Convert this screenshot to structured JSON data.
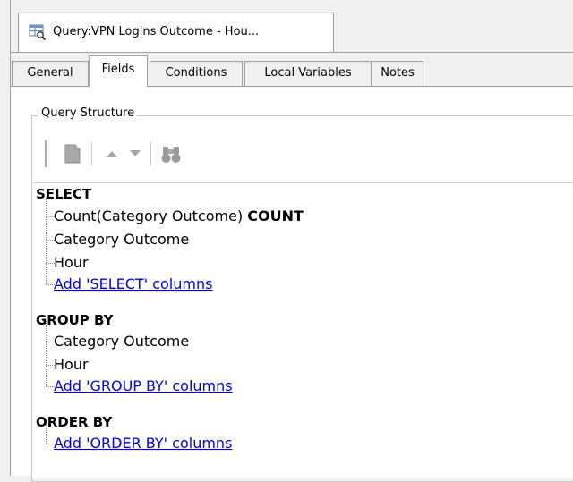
{
  "document_tab": {
    "title": "Query:VPN Logins Outcome - Hou...",
    "icon": "query-table-icon"
  },
  "tabs": [
    {
      "label": "General",
      "active": false
    },
    {
      "label": "Fields",
      "active": true
    },
    {
      "label": "Conditions",
      "active": false
    },
    {
      "label": "Local Variables",
      "active": false
    },
    {
      "label": "Notes",
      "active": false
    }
  ],
  "query_structure": {
    "label": "Query Structure",
    "toolbar": [
      "document-icon",
      "arrow-up-icon",
      "arrow-down-icon",
      "binoculars-icon"
    ]
  },
  "tree": {
    "select": {
      "header": "SELECT",
      "items": [
        {
          "expr": "Count(Category Outcome)",
          "alias": "COUNT"
        },
        {
          "expr": "Category Outcome",
          "alias": ""
        },
        {
          "expr": "Hour",
          "alias": ""
        }
      ],
      "add_link": "Add 'SELECT' columns"
    },
    "group_by": {
      "header": "GROUP BY",
      "items": [
        "Category Outcome",
        "Hour"
      ],
      "add_link": "Add 'GROUP BY' columns"
    },
    "order_by": {
      "header": "ORDER BY",
      "add_link": "Add 'ORDER BY' columns"
    }
  },
  "colors": {
    "link": "#0000ee",
    "border": "#a0a0a0",
    "background": "#f0f0f0"
  }
}
